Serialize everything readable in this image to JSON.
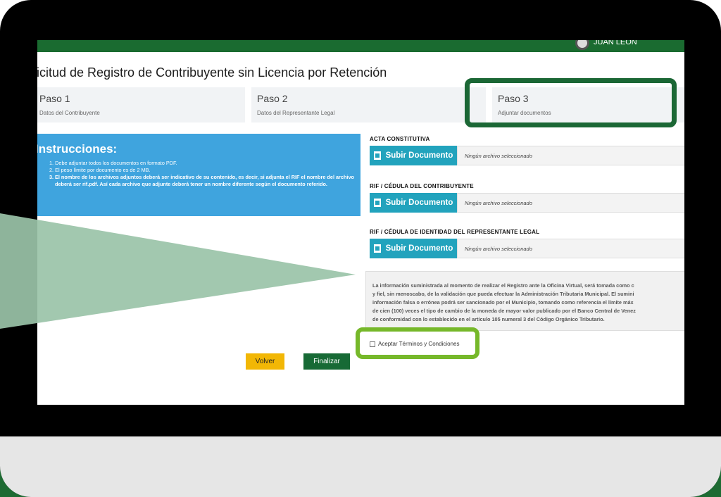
{
  "header": {
    "user_label": "JUAN LEÓN"
  },
  "page": {
    "title": "licitud de Registro de Contribuyente sin Licencia por Retención"
  },
  "steps": [
    {
      "name": "Paso 1",
      "desc": "Datos del Contribuyente"
    },
    {
      "name": "Paso 2",
      "desc": "Datos del Representante Legal"
    },
    {
      "name": "Paso 3",
      "desc": "Adjuntar documentos"
    }
  ],
  "instructions": {
    "heading": "Instrucciones:",
    "items": [
      "1. Debe adjuntar todos los documentos en formato PDF.",
      "2. El peso límite por documento es de 2 MB.",
      "3. El nombre de los archivos adjuntos deberá ser indicativo de su contenido, es decir, si adjunta el RIF el nombre del archivo deberá ser rif.pdf. Así cada archivo que adjunte deberá tener un nombre diferente según el documento referido."
    ],
    "item3_number": "3.",
    "item3_text": "El nombre de los archivos adjuntos deberá ser indicativo de su contenido, es decir, si adjunta el RIF el nombre del archivo deberá ser rif.pdf. Así cada archivo que adjunte deberá tener un nombre diferente según el documento referido."
  },
  "documents": [
    {
      "label": "ACTA CONSTITUTIVA",
      "button": "Subir Documento",
      "file_placeholder": "Ningún archivo seleccionado"
    },
    {
      "label": "RIF / CÉDULA DEL CONTRIBUYENTE",
      "button": "Subir Documento",
      "file_placeholder": "Ningún archivo seleccionado"
    },
    {
      "label": "RIF / CÉDULA DE IDENTIDAD DEL REPRESENTANTE LEGAL",
      "button": "Subir Documento",
      "file_placeholder": "Ningún archivo seleccionado"
    }
  ],
  "legal_lines": [
    "La información suministrada al momento de realizar el Registro ante la Oficina Virtual, será tomada como c",
    "y fiel, sin menoscabo, de la validación que pueda efectuar la Administración Tributaria Municipal. El sumini",
    "información falsa o errónea podrá ser sancionado por el Municipio, tomando como referencia el límite máx",
    "de cien (100) veces el tipo de cambio de la moneda de mayor valor publicado por el Banco Central de Venez",
    "de conformidad con lo establecido en el artículo 105 numeral 3 del Código Orgánico Tributario."
  ],
  "terms_label": "Aceptar Términos y Condiciones",
  "buttons": {
    "back": "Volver",
    "finish": "Finalizar"
  },
  "colors": {
    "brand_green": "#1a6b30",
    "info_blue": "#3fa4de",
    "upload_teal": "#22a3bd",
    "highlight_lime": "#76b82a",
    "back_yellow": "#f2b705"
  }
}
